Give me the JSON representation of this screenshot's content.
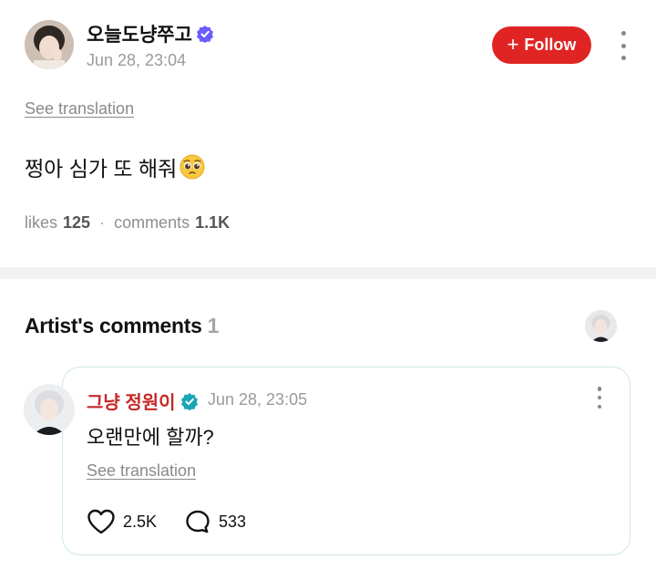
{
  "post": {
    "author_name": "오늘도냥쭈고",
    "timestamp": "Jun 28, 23:04",
    "follow_label": "Follow",
    "see_translation": "See translation",
    "body_text": "쩡아 심가 또 해줘",
    "body_emoji": "pleading-face",
    "likes_label": "likes",
    "likes_count": "125",
    "comments_label": "comments",
    "comments_count": "1.1K"
  },
  "artist_comments": {
    "title": "Artist's comments",
    "count": "1"
  },
  "comment": {
    "author_name": "그냥 정원이",
    "timestamp": "Jun 28, 23:05",
    "body_text": "오랜만에 할까?",
    "see_translation": "See translation",
    "likes_count": "2.5K",
    "replies_count": "533"
  },
  "colors": {
    "follow_button": "#e02424",
    "artist_name": "#c62828",
    "verified_post": "#6a5cff",
    "verified_artist": "#1aa6b7",
    "card_border": "#cfe7ea"
  },
  "icons": [
    "verified-badge-icon",
    "plus-icon",
    "more-vertical-icon",
    "pleading-face-emoji",
    "heart-icon",
    "comment-bubble-icon"
  ]
}
